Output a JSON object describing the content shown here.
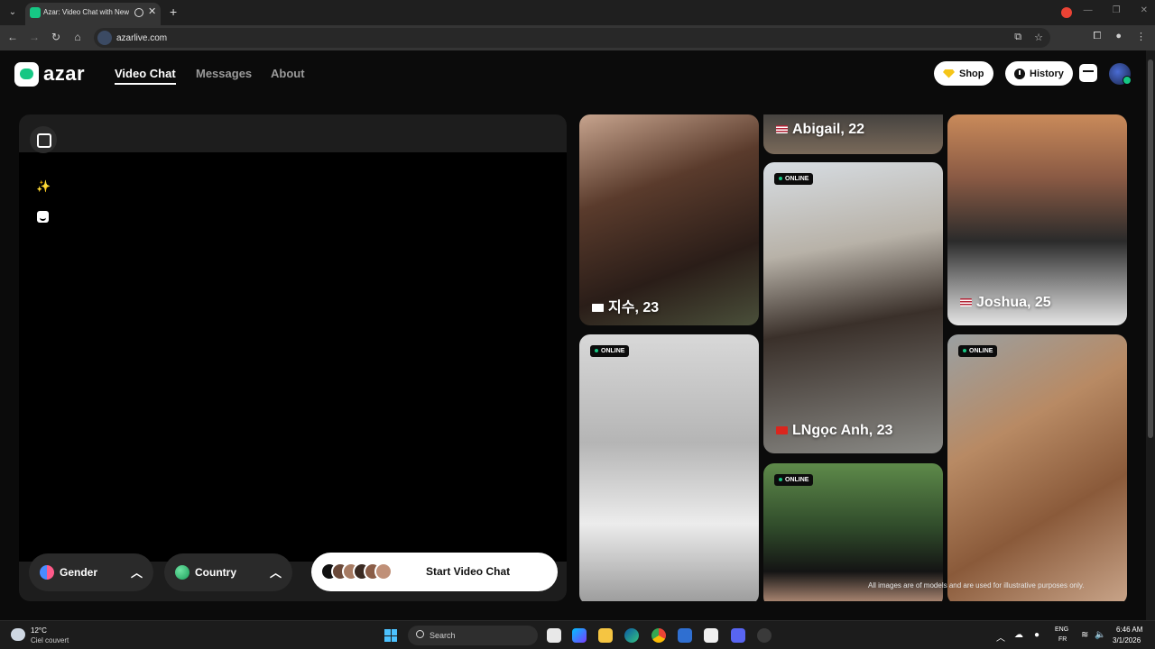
{
  "browser": {
    "tab_title": "Azar: Video Chat with New",
    "url": "azarlive.com"
  },
  "header": {
    "logo_text": "azar",
    "nav": [
      {
        "label": "Video Chat",
        "active": true
      },
      {
        "label": "Messages",
        "active": false
      },
      {
        "label": "About",
        "active": false
      }
    ],
    "shop_label": "Shop",
    "history_label": "History"
  },
  "video_panel": {
    "gender_label": "Gender",
    "country_label": "Country",
    "start_label": "Start Video Chat"
  },
  "cards": [
    {
      "name": "지수, 23",
      "flag": "kr",
      "online": false
    },
    {
      "name": "Abigail, 22",
      "flag": "us",
      "online": false
    },
    {
      "name": "Joshua, 25",
      "flag": "us",
      "online": false
    },
    {
      "name": "LNgọc Anh, 23",
      "flag": "vn",
      "online": true
    },
    {
      "name": "",
      "flag": "",
      "online": true
    },
    {
      "name": "",
      "flag": "",
      "online": true
    },
    {
      "name": "",
      "flag": "",
      "online": true
    }
  ],
  "online_label": "ONLINE",
  "disclaimer": "All images are of models and are used for illustrative purposes only.",
  "taskbar": {
    "weather_temp": "12°C",
    "weather_desc": "Ciel couvert",
    "search_label": "Search",
    "lang_top": "ENG",
    "lang_bottom": "FR",
    "time": "6:46 AM",
    "date": "3/1/2026"
  },
  "colors": {
    "accent": "#16c784",
    "page_bg": "#0b0b0b"
  }
}
